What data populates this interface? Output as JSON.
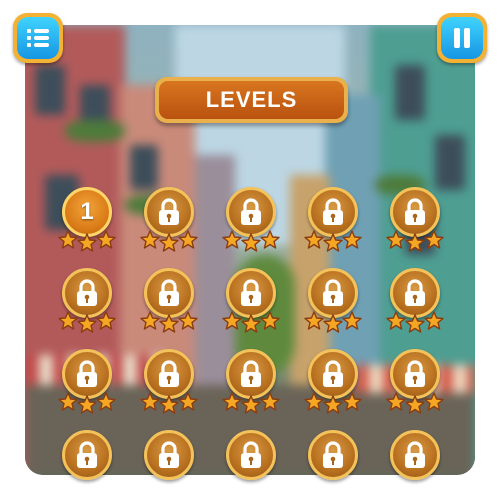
{
  "header": {
    "menu_icon": "list-menu-icon",
    "pause_icon": "pause-icon",
    "title": "LEVELS"
  },
  "colors": {
    "button_blue": "#1796e3",
    "button_frame": "#f3b233",
    "title_plate": "#c8621a",
    "coin": "#b8701f",
    "star": "#f5a623"
  },
  "levels": [
    {
      "label": "1",
      "locked": false,
      "stars": 3
    },
    {
      "label": "",
      "locked": true,
      "stars": 3
    },
    {
      "label": "",
      "locked": true,
      "stars": 3
    },
    {
      "label": "",
      "locked": true,
      "stars": 3
    },
    {
      "label": "",
      "locked": true,
      "stars": 3
    },
    {
      "label": "",
      "locked": true,
      "stars": 3
    },
    {
      "label": "",
      "locked": true,
      "stars": 3
    },
    {
      "label": "",
      "locked": true,
      "stars": 3
    },
    {
      "label": "",
      "locked": true,
      "stars": 3
    },
    {
      "label": "",
      "locked": true,
      "stars": 3
    },
    {
      "label": "",
      "locked": true,
      "stars": 3
    },
    {
      "label": "",
      "locked": true,
      "stars": 3
    },
    {
      "label": "",
      "locked": true,
      "stars": 3
    },
    {
      "label": "",
      "locked": true,
      "stars": 3
    },
    {
      "label": "",
      "locked": true,
      "stars": 3
    },
    {
      "label": "",
      "locked": true,
      "stars": 0
    },
    {
      "label": "",
      "locked": true,
      "stars": 0
    },
    {
      "label": "",
      "locked": true,
      "stars": 0
    },
    {
      "label": "",
      "locked": true,
      "stars": 0
    },
    {
      "label": "",
      "locked": true,
      "stars": 0
    }
  ]
}
